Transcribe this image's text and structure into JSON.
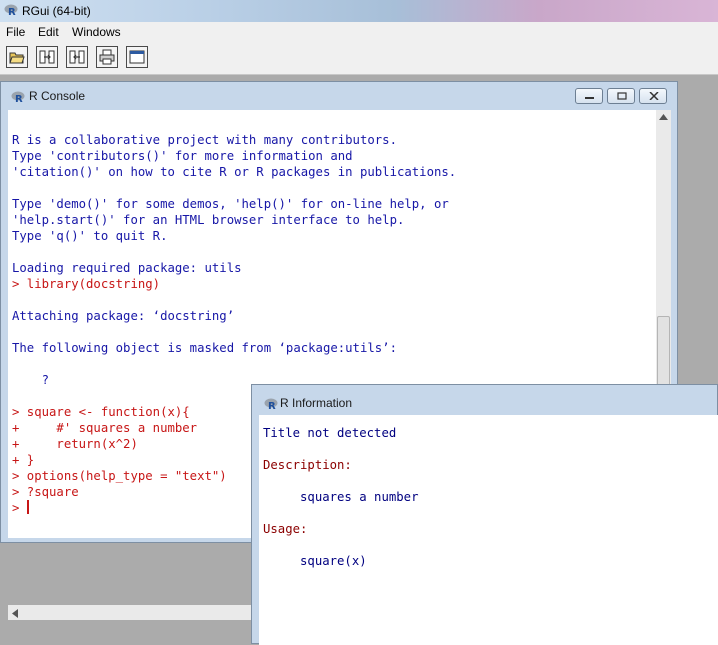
{
  "app": {
    "title": "RGui (64-bit)"
  },
  "menu": {
    "file": "File",
    "edit": "Edit",
    "windows": "Windows"
  },
  "toolbar": {
    "icons": [
      "open-script-icon",
      "load-workspace-icon",
      "save-workspace-icon",
      "print-icon",
      "console-icon"
    ]
  },
  "console": {
    "title": "R Console",
    "lines": [
      {
        "text": "R is a collaborative project with many contributors.",
        "color": "blue"
      },
      {
        "text": "Type 'contributors()' for more information and",
        "color": "blue"
      },
      {
        "text": "'citation()' on how to cite R or R packages in publications.",
        "color": "blue"
      },
      {
        "text": "",
        "color": "blue"
      },
      {
        "text": "Type 'demo()' for some demos, 'help()' for on-line help, or",
        "color": "blue"
      },
      {
        "text": "'help.start()' for an HTML browser interface to help.",
        "color": "blue"
      },
      {
        "text": "Type 'q()' to quit R.",
        "color": "blue"
      },
      {
        "text": "",
        "color": "blue"
      },
      {
        "text": "Loading required package: utils",
        "color": "blue"
      },
      {
        "text": "> library(docstring)",
        "color": "red"
      },
      {
        "text": "",
        "color": "blue"
      },
      {
        "text": "Attaching package: ‘docstring’",
        "color": "blue"
      },
      {
        "text": "",
        "color": "blue"
      },
      {
        "text": "The following object is masked from ‘package:utils’:",
        "color": "blue"
      },
      {
        "text": "",
        "color": "blue"
      },
      {
        "text": "    ?",
        "color": "blue"
      },
      {
        "text": "",
        "color": "blue"
      },
      {
        "text": "> square <- function(x){",
        "color": "red"
      },
      {
        "text": "+     #' squares a number",
        "color": "red"
      },
      {
        "text": "+     return(x^2)",
        "color": "red"
      },
      {
        "text": "+ }",
        "color": "red"
      },
      {
        "text": "> options(help_type = \"text\")",
        "color": "red"
      },
      {
        "text": "> ?square",
        "color": "red"
      }
    ],
    "prompt": "> "
  },
  "info": {
    "title": "R Information",
    "lines": [
      {
        "text": "Title not detected",
        "color": "navy"
      },
      {
        "text": "",
        "color": "navy"
      },
      {
        "text": "Description:",
        "color": "maroon"
      },
      {
        "text": "",
        "color": "navy"
      },
      {
        "text": "     squares a number",
        "color": "navy"
      },
      {
        "text": "",
        "color": "navy"
      },
      {
        "text": "Usage:",
        "color": "maroon"
      },
      {
        "text": "",
        "color": "navy"
      },
      {
        "text": "     square(x)",
        "color": "navy"
      }
    ]
  },
  "colors": {
    "console_blue": "#1717a7",
    "console_red": "#c71616",
    "info_navy": "#000080",
    "info_maroon": "#8b0000"
  }
}
